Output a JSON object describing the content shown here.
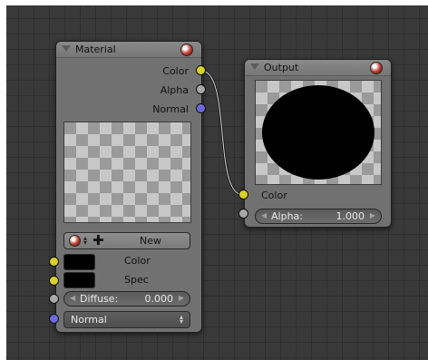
{
  "material_node": {
    "title": "Material",
    "outputs": [
      "Color",
      "Alpha",
      "Normal"
    ],
    "new_button": "New",
    "inputs": {
      "color_label": "Color",
      "spec_label": "Spec",
      "diffuse_label": "Diffuse:",
      "diffuse_value": "0.000",
      "normal_dropdown": "Normal"
    }
  },
  "output_node": {
    "title": "Output",
    "color_label": "Color",
    "alpha_label": "Alpha:",
    "alpha_value": "1.000"
  },
  "colors": {
    "socket_color": "#d9d12a",
    "socket_value": "#a8a8a8",
    "socket_vector": "#6a6ad8",
    "node_body": "#717171",
    "background": "#393939"
  },
  "icons": [
    "collapse-arrow-icon",
    "material-sphere-icon",
    "plus-icon",
    "up-down-arrows-icon"
  ]
}
